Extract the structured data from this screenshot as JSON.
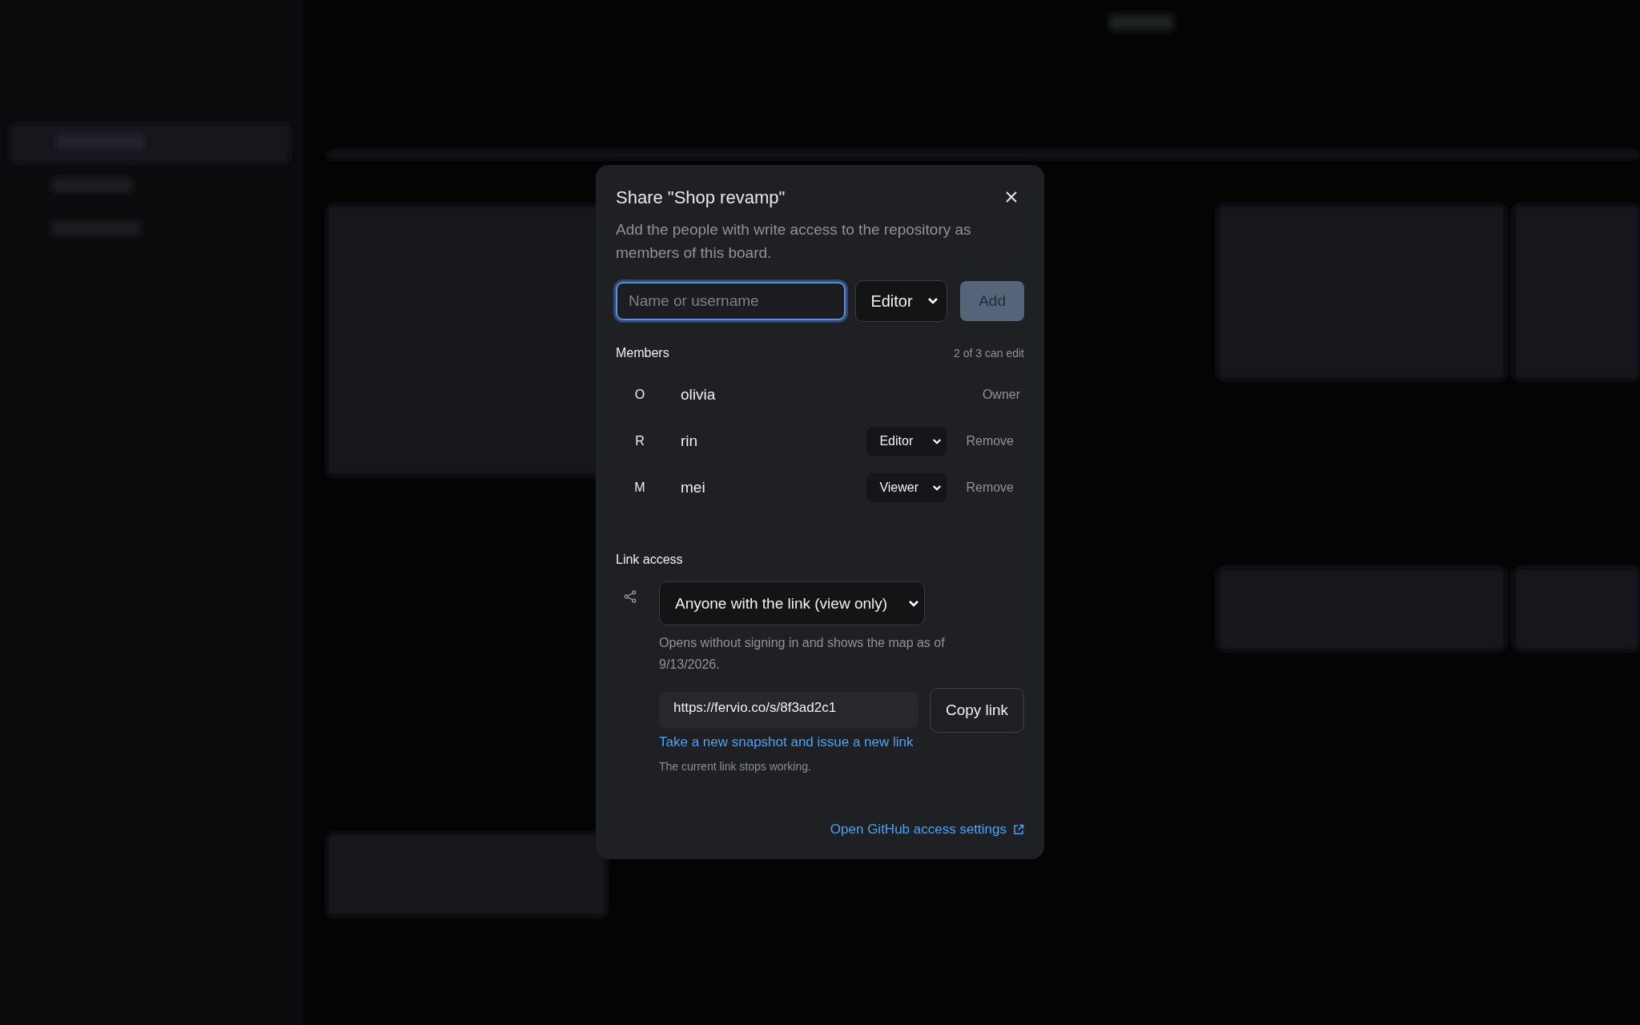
{
  "dialog": {
    "title": "Share \"Shop revamp\"",
    "description": "Add the people with write access to the repository as members of this board.",
    "add_member": {
      "placeholder": "Name or username",
      "focused": true,
      "role": "Editor",
      "add_label": "Add",
      "add_disabled": true
    },
    "members_section": {
      "title": "Members",
      "summary": "2 of 3 can edit",
      "members": [
        {
          "initial": "O",
          "name": "olivia",
          "kind": "owner",
          "role": "Owner"
        },
        {
          "initial": "R",
          "name": "rin",
          "kind": "editable",
          "role": "Editor",
          "action": "Remove"
        },
        {
          "initial": "M",
          "name": "mei",
          "kind": "editable",
          "role": "Viewer",
          "action": "Remove"
        }
      ]
    },
    "link_access": {
      "title": "Link access",
      "option": "Anyone with the link (view only)",
      "help": "Opens without signing in and shows the map as of 9/13/2026.",
      "url": "https://fervio.co/s/8f3ad2c1",
      "copy_label": "Copy link",
      "regenerate_link": "Take a new snapshot and issue a new link",
      "regenerate_note": "The current link stops working."
    },
    "footer_link": "Open GitHub access settings"
  }
}
